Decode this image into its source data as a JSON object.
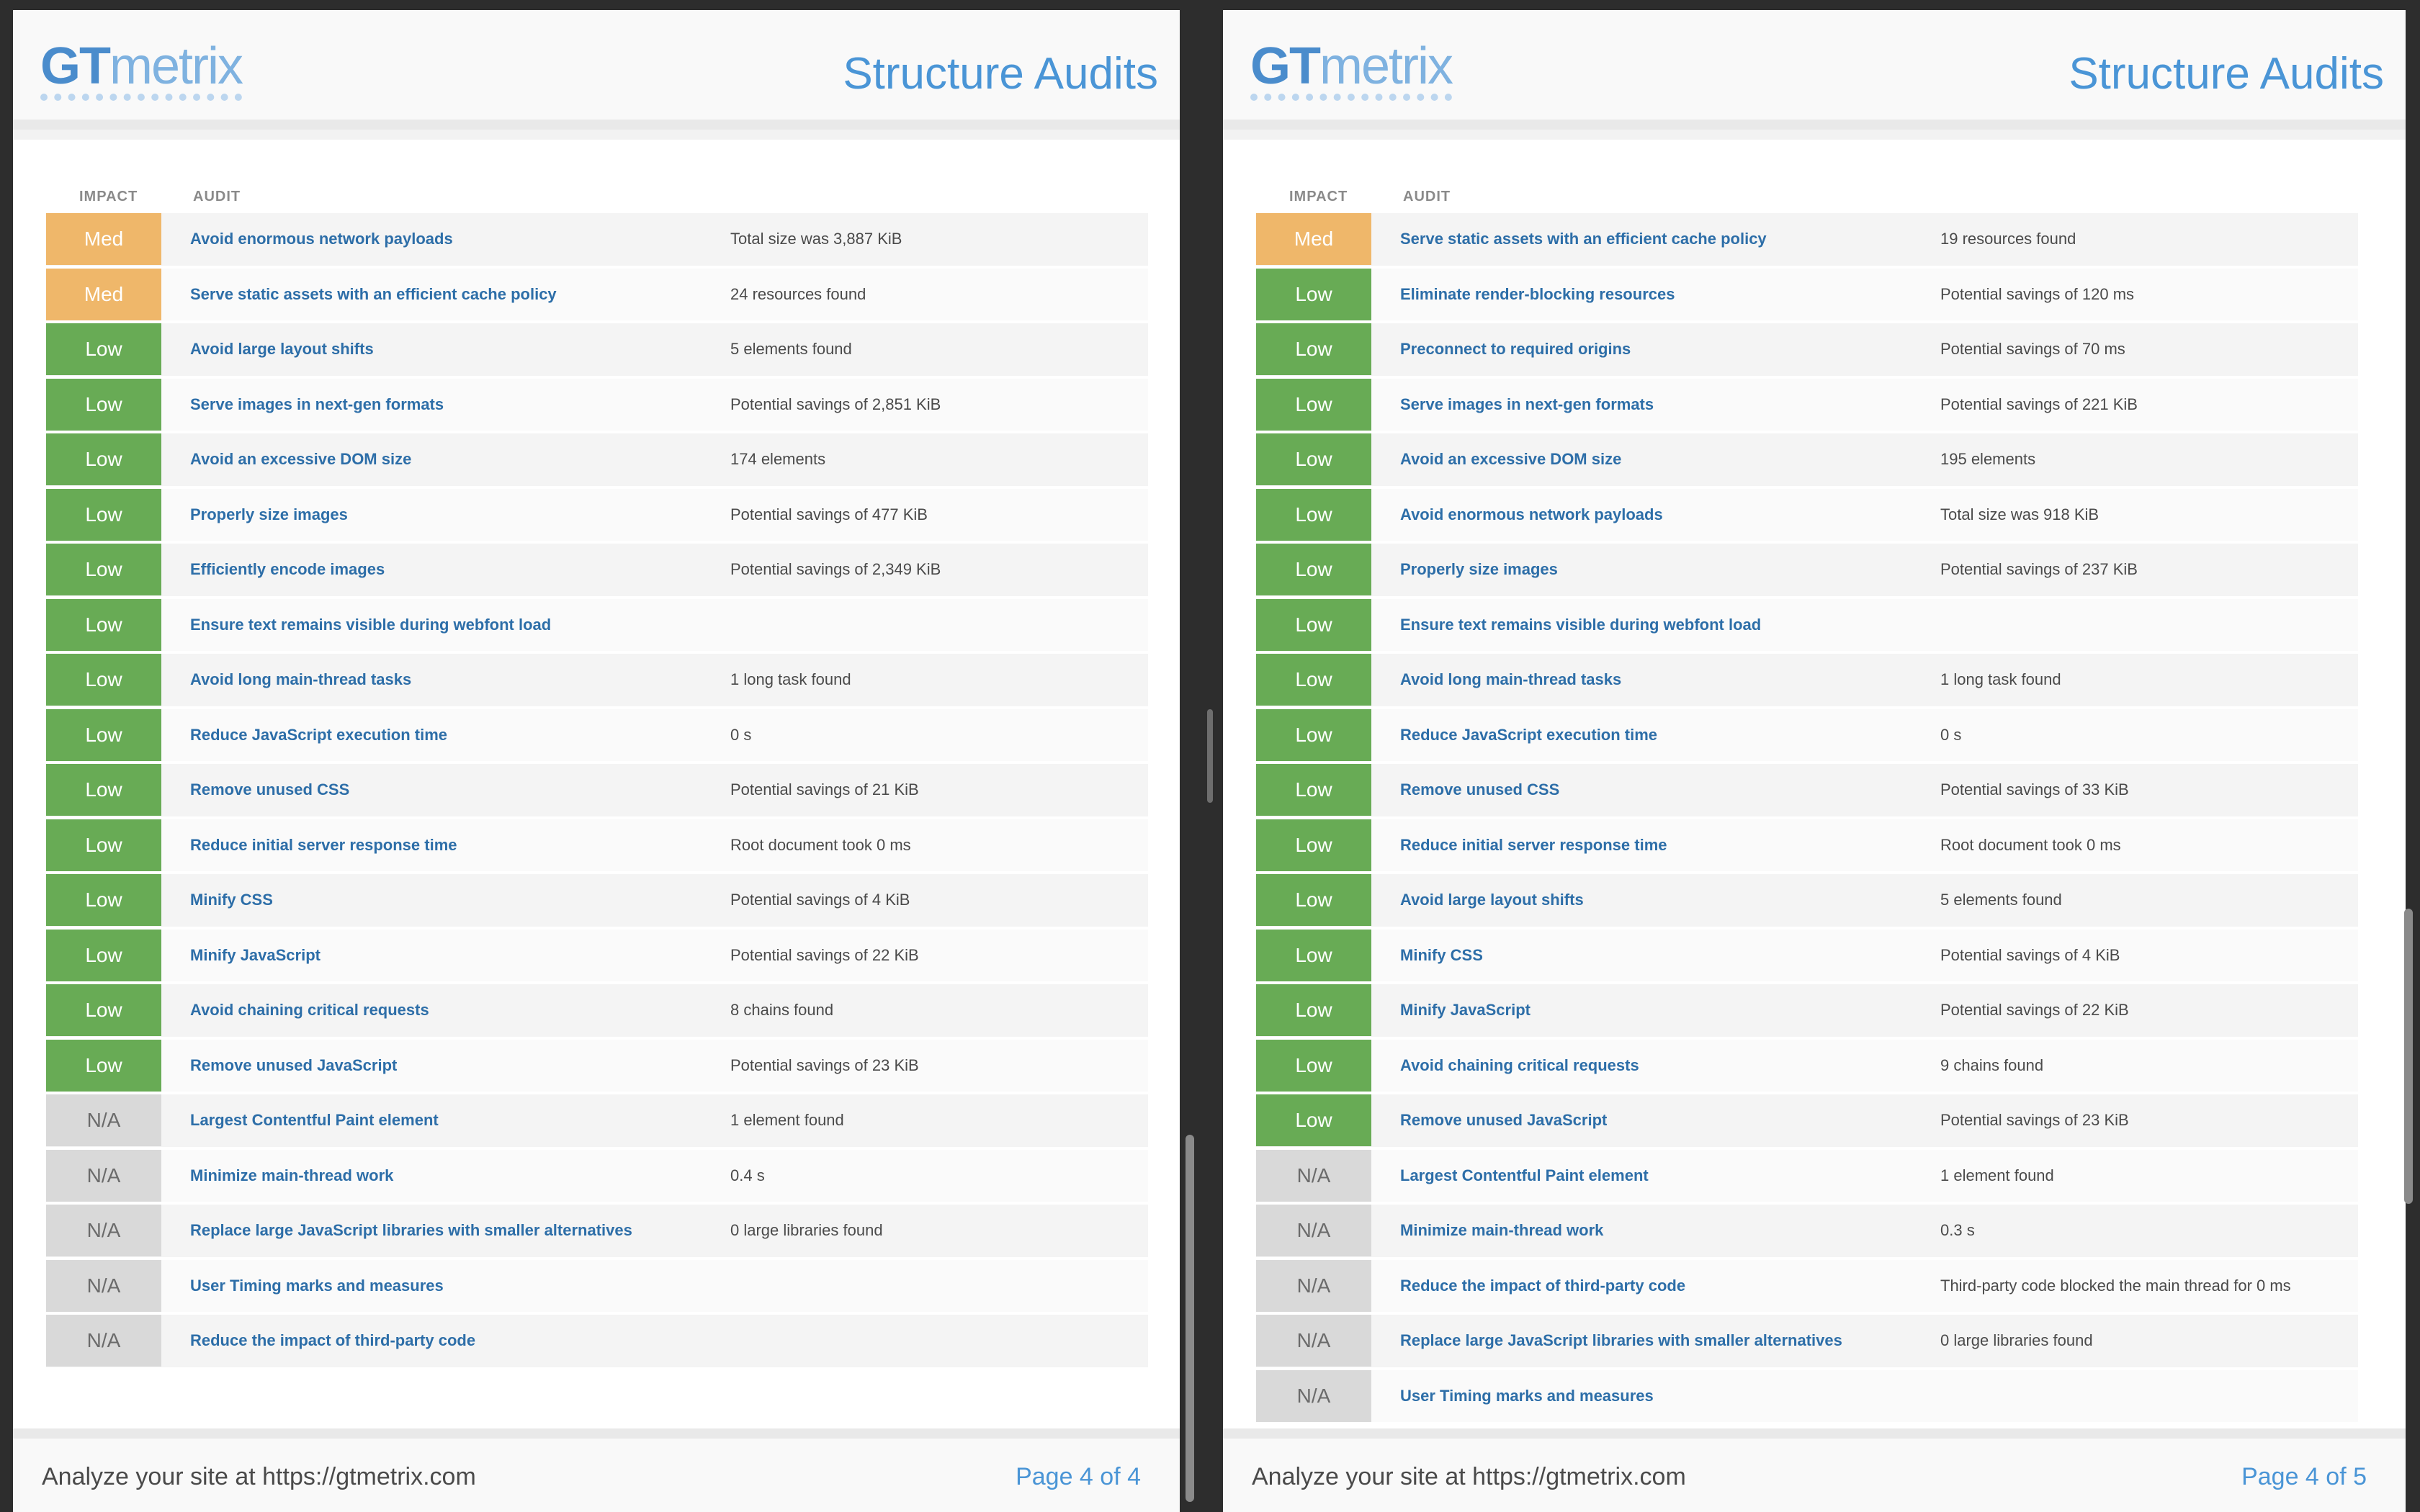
{
  "left": {
    "logo_gt": "GT",
    "logo_metrix": "metrix",
    "title": "Structure Audits",
    "col_impact": "IMPACT",
    "col_audit": "AUDIT",
    "rows": [
      {
        "impact": "Med",
        "level": "med",
        "audit": "Avoid enormous network payloads",
        "result": "Total size was 3,887 KiB"
      },
      {
        "impact": "Med",
        "level": "med",
        "audit": "Serve static assets with an efficient cache policy",
        "result": "24 resources found"
      },
      {
        "impact": "Low",
        "level": "low",
        "audit": "Avoid large layout shifts",
        "result": "5 elements found"
      },
      {
        "impact": "Low",
        "level": "low",
        "audit": "Serve images in next-gen formats",
        "result": "Potential savings of 2,851 KiB"
      },
      {
        "impact": "Low",
        "level": "low",
        "audit": "Avoid an excessive DOM size",
        "result": "174 elements"
      },
      {
        "impact": "Low",
        "level": "low",
        "audit": "Properly size images",
        "result": "Potential savings of 477 KiB"
      },
      {
        "impact": "Low",
        "level": "low",
        "audit": "Efficiently encode images",
        "result": "Potential savings of 2,349 KiB"
      },
      {
        "impact": "Low",
        "level": "low",
        "audit": "Ensure text remains visible during webfont load",
        "result": ""
      },
      {
        "impact": "Low",
        "level": "low",
        "audit": "Avoid long main-thread tasks",
        "result": "1 long task found"
      },
      {
        "impact": "Low",
        "level": "low",
        "audit": "Reduce JavaScript execution time",
        "result": "0 s"
      },
      {
        "impact": "Low",
        "level": "low",
        "audit": "Remove unused CSS",
        "result": "Potential savings of 21 KiB"
      },
      {
        "impact": "Low",
        "level": "low",
        "audit": "Reduce initial server response time",
        "result": "Root document took 0 ms"
      },
      {
        "impact": "Low",
        "level": "low",
        "audit": "Minify CSS",
        "result": "Potential savings of 4 KiB"
      },
      {
        "impact": "Low",
        "level": "low",
        "audit": "Minify JavaScript",
        "result": "Potential savings of 22 KiB"
      },
      {
        "impact": "Low",
        "level": "low",
        "audit": "Avoid chaining critical requests",
        "result": "8 chains found"
      },
      {
        "impact": "Low",
        "level": "low",
        "audit": "Remove unused JavaScript",
        "result": "Potential savings of 23 KiB"
      },
      {
        "impact": "N/A",
        "level": "na",
        "audit": "Largest Contentful Paint element",
        "result": "1 element found"
      },
      {
        "impact": "N/A",
        "level": "na",
        "audit": "Minimize main-thread work",
        "result": "0.4 s"
      },
      {
        "impact": "N/A",
        "level": "na",
        "audit": "Replace large JavaScript libraries with smaller alternatives",
        "result": "0 large libraries found"
      },
      {
        "impact": "N/A",
        "level": "na",
        "audit": "User Timing marks and measures",
        "result": ""
      },
      {
        "impact": "N/A",
        "level": "na",
        "audit": "Reduce the impact of third-party code",
        "result": ""
      }
    ],
    "footer_left": "Analyze your site at https://gtmetrix.com",
    "footer_right": "Page 4 of 4"
  },
  "right": {
    "logo_gt": "GT",
    "logo_metrix": "metrix",
    "title": "Structure Audits",
    "col_impact": "IMPACT",
    "col_audit": "AUDIT",
    "rows": [
      {
        "impact": "Med",
        "level": "med",
        "audit": "Serve static assets with an efficient cache policy",
        "result": "19 resources found"
      },
      {
        "impact": "Low",
        "level": "low",
        "audit": "Eliminate render-blocking resources",
        "result": "Potential savings of 120 ms"
      },
      {
        "impact": "Low",
        "level": "low",
        "audit": "Preconnect to required origins",
        "result": "Potential savings of 70 ms"
      },
      {
        "impact": "Low",
        "level": "low",
        "audit": "Serve images in next-gen formats",
        "result": "Potential savings of 221 KiB"
      },
      {
        "impact": "Low",
        "level": "low",
        "audit": "Avoid an excessive DOM size",
        "result": "195 elements"
      },
      {
        "impact": "Low",
        "level": "low",
        "audit": "Avoid enormous network payloads",
        "result": "Total size was 918 KiB"
      },
      {
        "impact": "Low",
        "level": "low",
        "audit": "Properly size images",
        "result": "Potential savings of 237 KiB"
      },
      {
        "impact": "Low",
        "level": "low",
        "audit": "Ensure text remains visible during webfont load",
        "result": ""
      },
      {
        "impact": "Low",
        "level": "low",
        "audit": "Avoid long main-thread tasks",
        "result": "1 long task found"
      },
      {
        "impact": "Low",
        "level": "low",
        "audit": "Reduce JavaScript execution time",
        "result": "0 s"
      },
      {
        "impact": "Low",
        "level": "low",
        "audit": "Remove unused CSS",
        "result": "Potential savings of 33 KiB"
      },
      {
        "impact": "Low",
        "level": "low",
        "audit": "Reduce initial server response time",
        "result": "Root document took 0 ms"
      },
      {
        "impact": "Low",
        "level": "low",
        "audit": "Avoid large layout shifts",
        "result": "5 elements found"
      },
      {
        "impact": "Low",
        "level": "low",
        "audit": "Minify CSS",
        "result": "Potential savings of 4 KiB"
      },
      {
        "impact": "Low",
        "level": "low",
        "audit": "Minify JavaScript",
        "result": "Potential savings of 22 KiB"
      },
      {
        "impact": "Low",
        "level": "low",
        "audit": "Avoid chaining critical requests",
        "result": "9 chains found"
      },
      {
        "impact": "Low",
        "level": "low",
        "audit": "Remove unused JavaScript",
        "result": "Potential savings of 23 KiB"
      },
      {
        "impact": "N/A",
        "level": "na",
        "audit": "Largest Contentful Paint element",
        "result": "1 element found"
      },
      {
        "impact": "N/A",
        "level": "na",
        "audit": "Minimize main-thread work",
        "result": "0.3 s"
      },
      {
        "impact": "N/A",
        "level": "na",
        "audit": "Reduce the impact of third-party code",
        "result": "Third-party code blocked the main thread for 0 ms"
      },
      {
        "impact": "N/A",
        "level": "na",
        "audit": "Replace large JavaScript libraries with smaller alternatives",
        "result": "0 large libraries found"
      },
      {
        "impact": "N/A",
        "level": "na",
        "audit": "User Timing marks and measures",
        "result": ""
      }
    ],
    "footer_left": "Analyze your site at https://gtmetrix.com",
    "footer_right": "Page 4 of 5"
  },
  "colors": {
    "med": "#efb76a",
    "low": "#68ab55",
    "na": "#d9d9d9",
    "link": "#2d6ea8",
    "accent": "#4a95d6"
  }
}
